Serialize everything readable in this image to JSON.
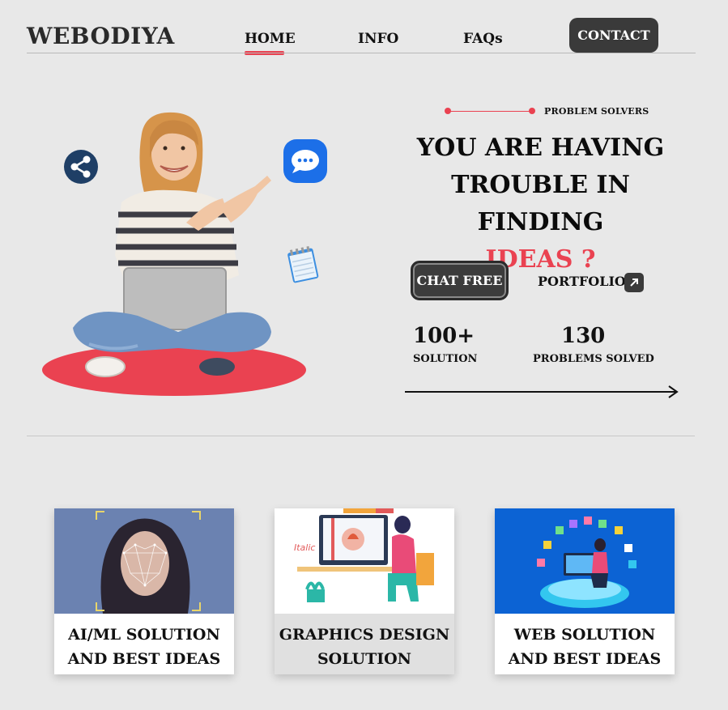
{
  "header": {
    "logo": "WEBODIYA",
    "nav": [
      "HOME",
      "INFO",
      "FAQs"
    ],
    "contact": "CONTACT"
  },
  "hero": {
    "tag": "PROBLEM SOLVERS",
    "headline_line1": "YOU ARE HAVING",
    "headline_line2": "TROUBLE IN FINDING",
    "headline_accent": "IDEAS ?",
    "chat_button": "CHAT FREE",
    "portfolio_link": "PORTFOLIO",
    "stats": [
      {
        "value": "100+",
        "label": "SOLUTION"
      },
      {
        "value": "130",
        "label": "PROBLEMS SOLVED"
      }
    ]
  },
  "cards": [
    {
      "line1": "AI/ML SOLUTION",
      "line2": "AND BEST IDEAS"
    },
    {
      "line1": "GRAPHICS DESIGN",
      "line2": "SOLUTION"
    },
    {
      "line1": "WEB SOLUTION",
      "line2": "AND BEST IDEAS"
    }
  ],
  "illustration_texts": {
    "italic_label": "Italic"
  },
  "colors": {
    "accent": "#ea4251",
    "dark_button": "#3a3a3a",
    "background": "#e8e8e8",
    "card_blue": "#0c63d4"
  },
  "icons": [
    "share-icon",
    "chat-bubble-icon",
    "notepad-icon",
    "arrow-up-right-icon",
    "arrow-right-icon"
  ]
}
